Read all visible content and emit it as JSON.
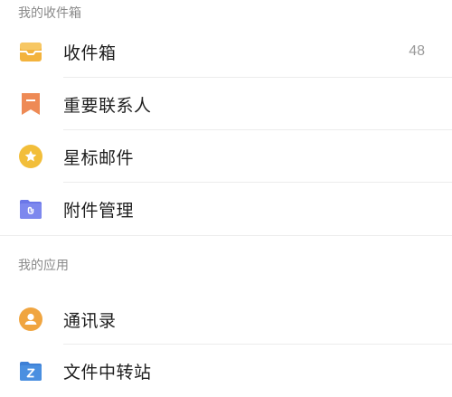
{
  "inbox_section": {
    "title": "我的收件箱",
    "items": [
      {
        "label": "收件箱",
        "count": "48",
        "icon": "inbox-tray-icon"
      },
      {
        "label": "重要联系人",
        "count": "",
        "icon": "bookmark-icon"
      },
      {
        "label": "星标邮件",
        "count": "",
        "icon": "star-icon"
      },
      {
        "label": "附件管理",
        "count": "",
        "icon": "attachment-folder-icon"
      }
    ]
  },
  "apps_section": {
    "title": "我的应用",
    "items": [
      {
        "label": "通讯录",
        "icon": "contacts-icon"
      },
      {
        "label": "文件中转站",
        "icon": "file-transfer-folder-icon"
      }
    ]
  },
  "colors": {
    "inbox_icon": "#F3B33D",
    "bookmark_icon": "#EE8A55",
    "star_icon": "#F2BE3A",
    "attachment_icon": "#6B77E8",
    "contacts_icon": "#F0A540",
    "file_transfer_icon": "#4A8FE0"
  }
}
